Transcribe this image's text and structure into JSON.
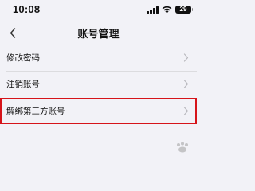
{
  "status_bar": {
    "time": "10:08",
    "battery_level": "29"
  },
  "nav": {
    "back_icon": "chevron-left-icon",
    "title": "账号管理"
  },
  "menu": {
    "items": [
      {
        "label": "修改密码",
        "icon": "chevron-right-icon",
        "highlighted": false
      },
      {
        "label": "注销账号",
        "icon": "chevron-right-icon",
        "highlighted": false
      },
      {
        "label": "解绑第三方账号",
        "icon": "chevron-right-icon",
        "highlighted": true
      }
    ]
  },
  "colors": {
    "background": "#f2f2f7",
    "highlight_border": "#d6141a",
    "text": "#111111"
  },
  "watermark": {
    "brand": "Baidu jingyan"
  }
}
